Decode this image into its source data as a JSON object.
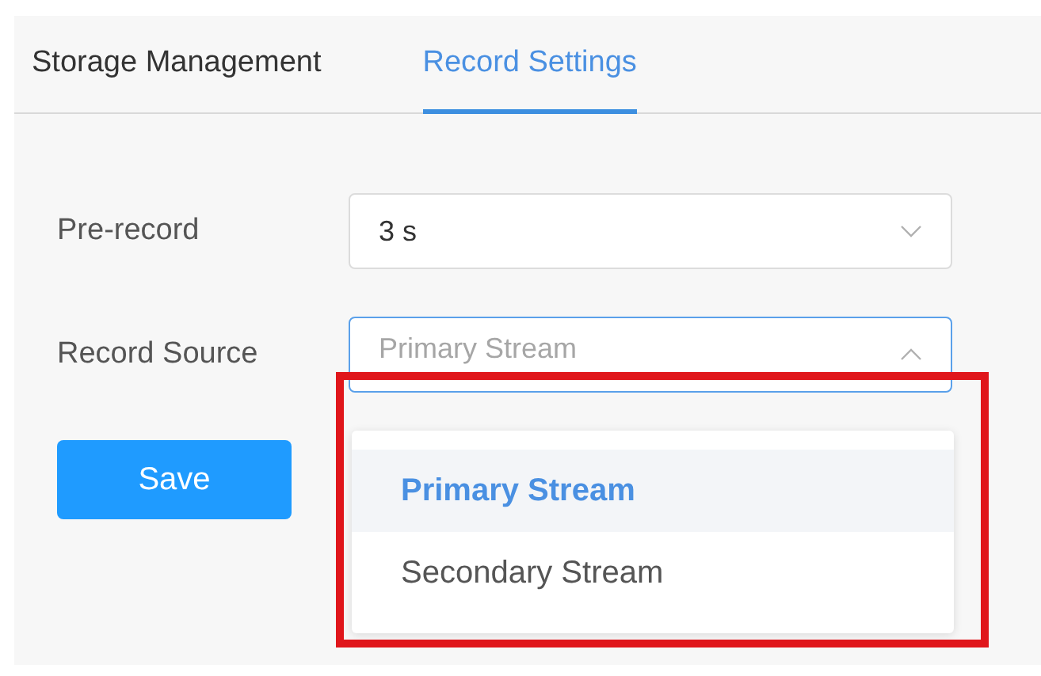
{
  "tabs": [
    {
      "label": "Storage Management",
      "selected": false
    },
    {
      "label": "Record Settings",
      "selected": true
    }
  ],
  "fields": [
    {
      "label": "Pre-record",
      "value": "3 s",
      "expanded": false
    },
    {
      "label": "Record Source",
      "placeholder": "Primary Stream",
      "expanded": true
    }
  ],
  "dropdown": {
    "options": [
      {
        "label": "Primary Stream",
        "selected": true
      },
      {
        "label": "Secondary Stream",
        "selected": false
      }
    ]
  },
  "save_button": "Save"
}
